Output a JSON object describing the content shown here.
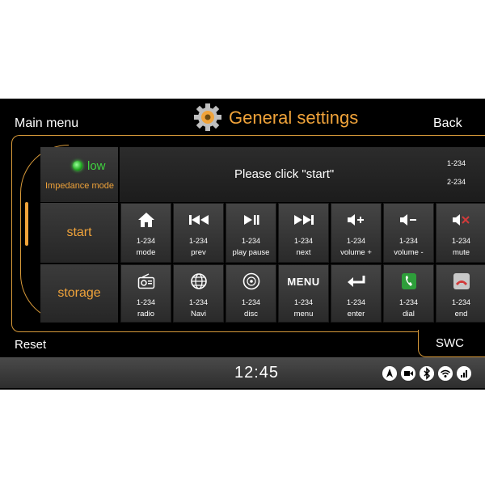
{
  "header": {
    "main_menu": "Main menu",
    "title": "General settings",
    "back": "Back"
  },
  "impedance": {
    "indicator": "low",
    "label": "Impedance mode"
  },
  "message": {
    "text": "Please click \"start\"",
    "code1": "1-234",
    "code2": "2-234"
  },
  "rows": {
    "start": "start",
    "storage": "storage"
  },
  "start_buttons": [
    {
      "icon": "home-icon",
      "code": "1-234",
      "label": "mode"
    },
    {
      "icon": "prev-icon",
      "code": "1-234",
      "label": "prev"
    },
    {
      "icon": "play-pause-icon",
      "code": "1-234",
      "label": "play pause"
    },
    {
      "icon": "next-icon",
      "code": "1-234",
      "label": "next"
    },
    {
      "icon": "volume-up-icon",
      "code": "1-234",
      "label": "volume +"
    },
    {
      "icon": "volume-down-icon",
      "code": "1-234",
      "label": "volume -"
    },
    {
      "icon": "mute-icon",
      "code": "1-234",
      "label": "mute"
    }
  ],
  "storage_buttons": [
    {
      "icon": "radio-icon",
      "code": "1-234",
      "label": "radio"
    },
    {
      "icon": "globe-icon",
      "code": "1-234",
      "label": "Navi"
    },
    {
      "icon": "disc-icon",
      "code": "1-234",
      "label": "disc"
    },
    {
      "icon": "menu-text-icon",
      "icon_text": "MENU",
      "code": "1-234",
      "label": "menu"
    },
    {
      "icon": "enter-icon",
      "code": "1-234",
      "label": "enter"
    },
    {
      "icon": "dial-icon",
      "code": "1-234",
      "label": "dial"
    },
    {
      "icon": "end-call-icon",
      "code": "1-234",
      "label": "end"
    }
  ],
  "footer": {
    "reset": "Reset",
    "swc": "SWC"
  },
  "status": {
    "time": "12:45",
    "icons": [
      "navigation-icon",
      "camera-icon",
      "bluetooth-icon",
      "wifi-icon",
      "signal-icon"
    ]
  },
  "colors": {
    "accent": "#f0a33a",
    "led": "#3fd13f",
    "dial_green": "#2e9e3a",
    "end_red": "#d23a3a"
  }
}
